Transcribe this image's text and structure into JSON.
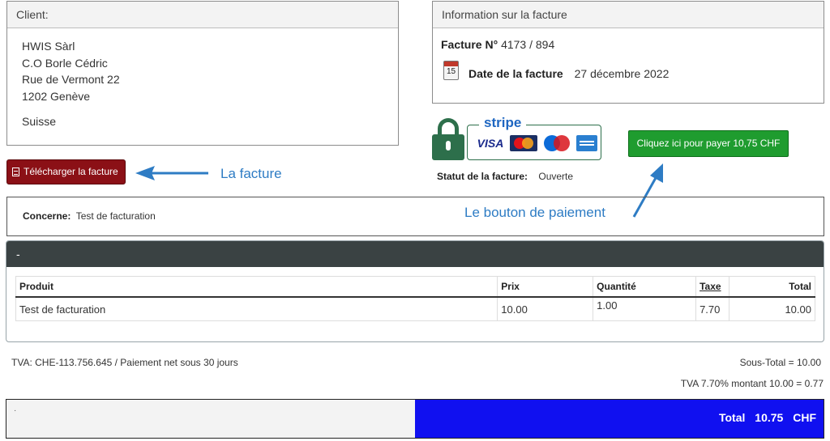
{
  "client": {
    "header": "Client:",
    "lines": [
      "HWIS Sàrl",
      "C.O Borle Cédric",
      "Rue de Vermont 22",
      "1202 Genève"
    ],
    "country": "Suisse"
  },
  "invoice_info": {
    "header": "Information sur la facture",
    "number_label": "Facture N°",
    "number_value": "4173",
    "number_sep": "/",
    "number_total": "894",
    "date_icon_text": "15",
    "date_label": "Date de la facture",
    "date_value": "27 décembre 2022"
  },
  "download_button": {
    "label": "Télécharger la facture"
  },
  "annotations": {
    "invoice": "La facture",
    "payment": "Le bouton de paiement",
    "color": "#2e7cc4"
  },
  "payment": {
    "stripe_label": "stripe",
    "card_visa": "VISA",
    "pay_button": "Cliquez ici pour payer 10,75 CHF",
    "status_label": "Statut de la facture:",
    "status_value": "Ouverte"
  },
  "concerne": {
    "label": "Concerne:",
    "value": "Test de facturation"
  },
  "products": {
    "section_title": "-",
    "columns": {
      "product": "Produit",
      "price": "Prix",
      "qty": "Quantité",
      "tax": "Taxe",
      "total": "Total"
    },
    "rows": [
      {
        "product": "Test de facturation",
        "price": "10.00",
        "qty": "1.00",
        "tax": "7.70",
        "total": "10.00"
      }
    ]
  },
  "footer": {
    "tva": "TVA: CHE-113.756.645 / Paiement net sous 30 jours",
    "subtotal": "Sous-Total = 10.00",
    "tva_amount": "TVA 7.70% montant 10.00 = 0.77",
    "left_note": "·",
    "total_label": "Total",
    "total_value": "10.75",
    "currency": "CHF"
  },
  "colors": {
    "download": "#8b1016",
    "pay": "#1f9c2f",
    "total_bg": "#1010f0",
    "products_head": "#3a4243",
    "lock": "#2d6f4b"
  }
}
